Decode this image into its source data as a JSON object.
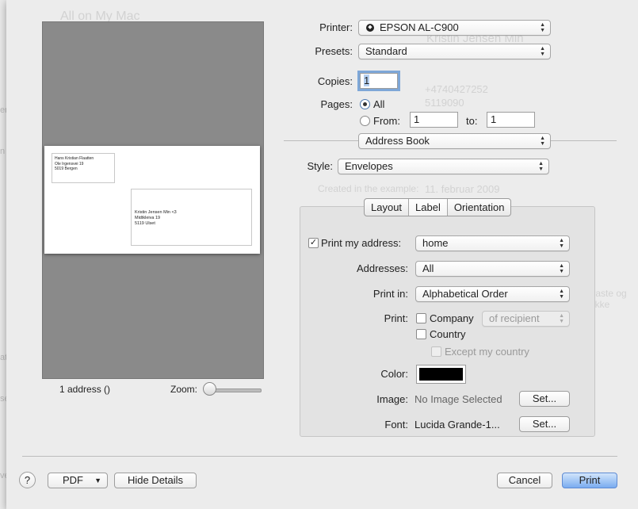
{
  "colors": {
    "accent": "#7aacf0",
    "label_color": "#000000"
  },
  "background": {
    "window_title": "All on My Mac",
    "contact_name": "Kristin Jensen Min",
    "phone": "+4740427252",
    "zip": "5119090",
    "date_label": "Created in the example:",
    "date": "11. februar 2009",
    "side_text": "traste og ekke",
    "side_cut": [
      "er",
      "n",
      "atten",
      "sen",
      "ve"
    ]
  },
  "preview": {
    "sender": [
      "Hans Kristian Flaatten",
      "Ole Irgensvei 19",
      "5019 Bergen"
    ],
    "recipient": [
      "Kristin Jensen Min <3",
      "Midtkleiva 19",
      "5119 Ulset"
    ],
    "count_label": "1 address ()",
    "zoom_label": "Zoom:"
  },
  "printer": {
    "label": "Printer:",
    "value": "EPSON AL-C900",
    "icon": "printer-status-icon"
  },
  "presets": {
    "label": "Presets:",
    "value": "Standard"
  },
  "copies": {
    "label": "Copies:",
    "value": "1"
  },
  "pages": {
    "label": "Pages:",
    "all_label": "All",
    "from_label": "From:",
    "from_value": "1",
    "to_label": "to:",
    "to_value": "1"
  },
  "app_popup": {
    "value": "Address Book"
  },
  "style": {
    "label": "Style:",
    "value": "Envelopes"
  },
  "tabs": [
    {
      "label": "Layout"
    },
    {
      "label": "Label",
      "active": true
    },
    {
      "label": "Orientation"
    }
  ],
  "label_panel": {
    "print_my_address": {
      "label": "Print my address:",
      "checked": true,
      "value": "home"
    },
    "addresses": {
      "label": "Addresses:",
      "value": "All"
    },
    "print_in": {
      "label": "Print in:",
      "value": "Alphabetical Order"
    },
    "print": {
      "label": "Print:",
      "company": "Company",
      "of_recipient": "of recipient",
      "country": "Country",
      "except": "Except my country"
    },
    "color": {
      "label": "Color:"
    },
    "image": {
      "label": "Image:",
      "value": "No Image Selected",
      "button": "Set..."
    },
    "font": {
      "label": "Font:",
      "value": "Lucida Grande-1...",
      "button": "Set..."
    }
  },
  "footer": {
    "help": "?",
    "pdf": "PDF",
    "hide_details": "Hide Details",
    "cancel": "Cancel",
    "print": "Print"
  }
}
